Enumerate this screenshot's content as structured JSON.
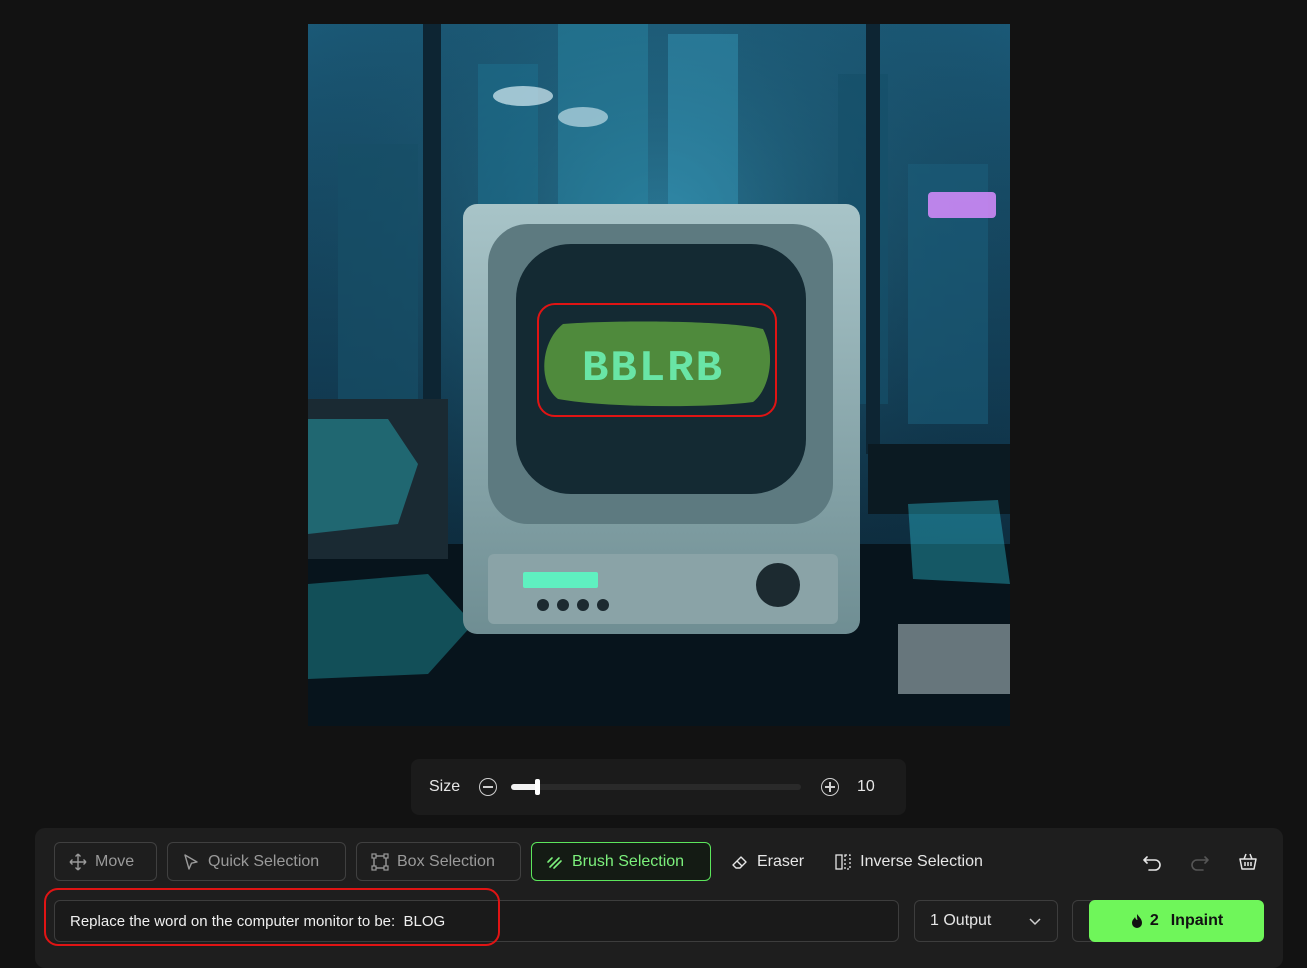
{
  "canvas": {
    "screen_text": "BBLRB"
  },
  "size_control": {
    "label": "Size",
    "value": "10",
    "fraction": 0.095
  },
  "toolbar": {
    "move": "Move",
    "quick_selection": "Quick Selection",
    "box_selection": "Box Selection",
    "brush_selection": "Brush Selection",
    "eraser": "Eraser",
    "inverse_selection": "Inverse Selection"
  },
  "prompt": {
    "value": "Replace the word on the computer monitor to be:  BLOG"
  },
  "output_select": {
    "selected": "1 Output"
  },
  "inpaint": {
    "credits": "2",
    "label": "Inpaint"
  },
  "colors": {
    "accent": "#6ff65a",
    "annotation": "#e01414",
    "background": "#121212"
  }
}
